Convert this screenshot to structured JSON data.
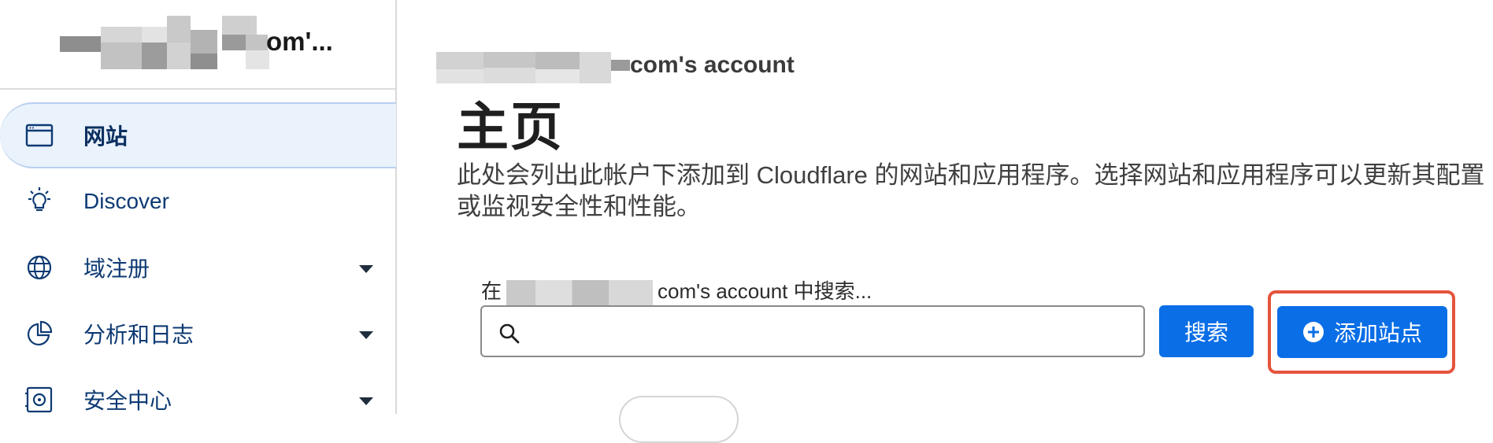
{
  "sidebar": {
    "account_name_suffix": "om'...",
    "items": [
      {
        "label": "网站",
        "icon": "browser-window-icon",
        "active": true,
        "has_caret": false
      },
      {
        "label": "Discover",
        "icon": "lightbulb-icon",
        "active": false,
        "has_caret": false
      },
      {
        "label": "域注册",
        "icon": "globe-icon",
        "active": false,
        "has_caret": true
      },
      {
        "label": "分析和日志",
        "icon": "pie-chart-icon",
        "active": false,
        "has_caret": true
      },
      {
        "label": "安全中心",
        "icon": "safe-icon",
        "active": false,
        "has_caret": true
      }
    ]
  },
  "main": {
    "account_line_suffix": "com's account",
    "title": "主页",
    "description": "此处会列出此帐户下添加到 Cloudflare 的网站和应用程序。选择网站和应用程序可以更新其配置或监视安全性和性能。",
    "search": {
      "label_prefix": "在",
      "label_suffix": "com's account 中搜索...",
      "value": "",
      "button_label": "搜索"
    },
    "add_site_label": "添加站点"
  },
  "colors": {
    "primary": "#0a6ee6",
    "nav_text": "#0e3a73",
    "active_bg": "#eaf2fc",
    "highlight": "#e5543d"
  }
}
